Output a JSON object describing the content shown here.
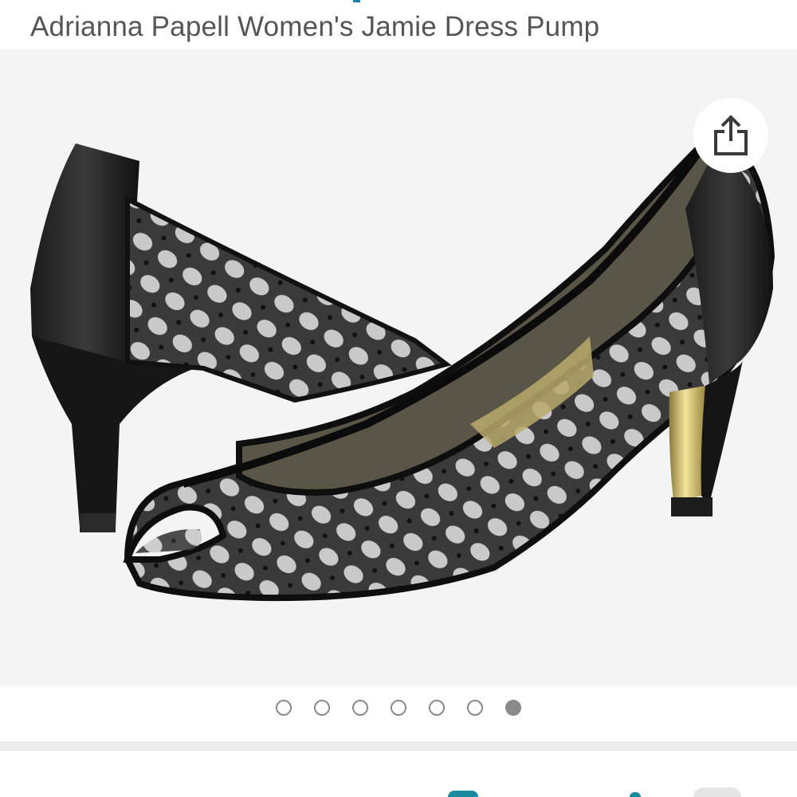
{
  "product": {
    "title": "Adrianna Papell Women's Jamie Dress Pump"
  },
  "gallery": {
    "image_alt": "Black mesh peep-toe dress pumps",
    "share_icon": "share-icon",
    "page_count": 7,
    "active_index": 6
  },
  "colors": {
    "title": "#555555",
    "gallery_bg": "#f4f4f4",
    "dot": "#8a8a8a"
  }
}
